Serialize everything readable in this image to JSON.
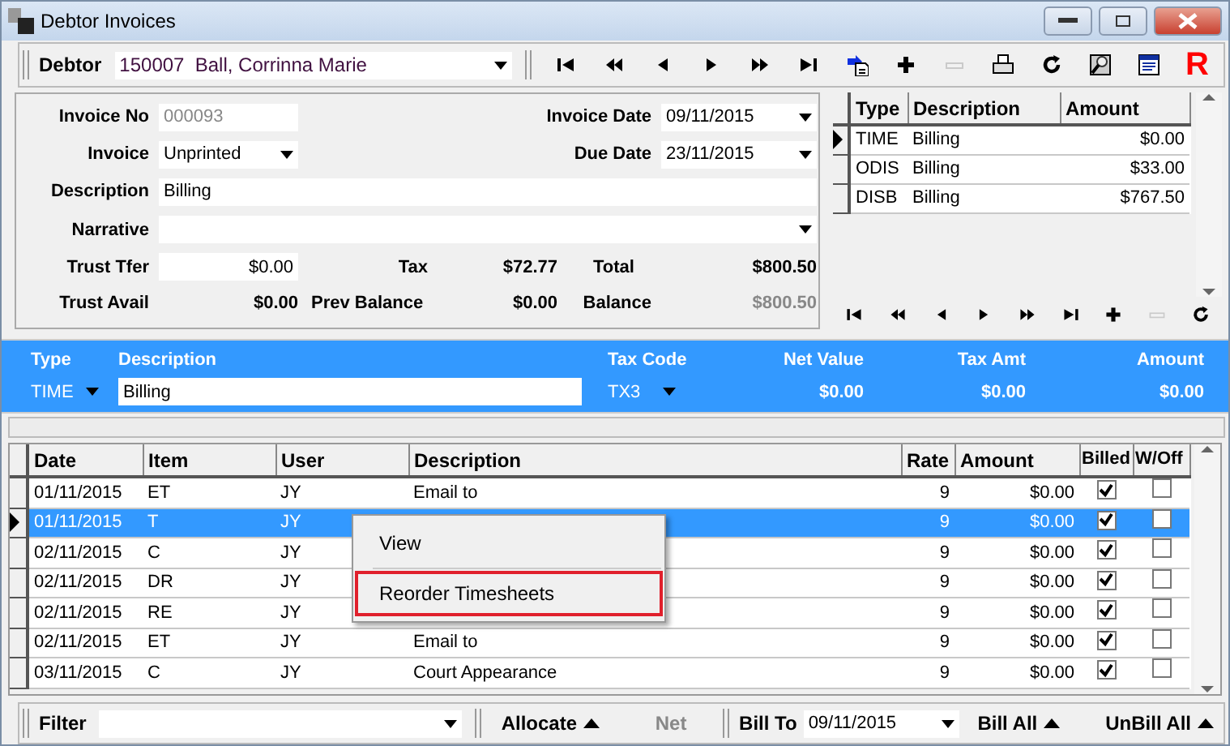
{
  "window": {
    "title": "Debtor Invoices"
  },
  "toolbar": {
    "debtor_label": "Debtor",
    "debtor_value": "150007  Ball, Corrinna Marie",
    "tools": [
      {
        "kind": "first",
        "disabled": false
      },
      {
        "kind": "prevpage",
        "disabled": false
      },
      {
        "kind": "prev",
        "disabled": false
      },
      {
        "kind": "next",
        "disabled": false
      },
      {
        "kind": "nextpage",
        "disabled": false
      },
      {
        "kind": "last",
        "disabled": false
      },
      {
        "kind": "import",
        "disabled": false
      },
      {
        "kind": "add",
        "disabled": false
      },
      {
        "kind": "remove",
        "disabled": true
      },
      {
        "kind": "print",
        "disabled": false
      },
      {
        "kind": "refresh",
        "disabled": false
      },
      {
        "kind": "find",
        "disabled": false
      },
      {
        "kind": "doc",
        "disabled": false
      },
      {
        "kind": "text",
        "label": "R",
        "disabled": false
      }
    ]
  },
  "invoice": {
    "invoice_no": {
      "label": "Invoice No",
      "value": "000093",
      "disabled": true
    },
    "invoice_date": {
      "label": "Invoice Date",
      "value": "09/11/2015"
    },
    "status": {
      "label": "Invoice",
      "value": "Unprinted"
    },
    "due_date": {
      "label": "Due Date",
      "value": "23/11/2015"
    },
    "description": {
      "label": "Description",
      "value": "Billing"
    },
    "narrative": {
      "label": "Narrative"
    },
    "trust_tfer": {
      "label": "Trust Tfer",
      "value": "$0.00"
    },
    "tax": {
      "label": "Tax",
      "value": "$72.77"
    },
    "total": {
      "label": "Total",
      "value": "$800.50"
    },
    "trust_avail": {
      "label": "Trust Avail",
      "value": "$0.00"
    },
    "prev_balance": {
      "label": "Prev Balance",
      "value": "$0.00"
    },
    "balance": {
      "label": "Balance",
      "value": "$800.50",
      "disabled": true
    }
  },
  "lines": {
    "columns": [
      "Type",
      "Description",
      "Amount"
    ],
    "rows": [
      {
        "type": "TIME",
        "description": "Billing",
        "amount": "$0.00",
        "selected": true
      },
      {
        "type": "ODIS",
        "description": "Billing",
        "amount": "$33.00",
        "selected": false
      },
      {
        "type": "DISB",
        "description": "Billing",
        "amount": "$767.50",
        "selected": false
      }
    ],
    "nav": [
      {
        "kind": "first",
        "disabled": false
      },
      {
        "kind": "prevpage",
        "disabled": false
      },
      {
        "kind": "prev",
        "disabled": false
      },
      {
        "kind": "next",
        "disabled": false
      },
      {
        "kind": "nextpage",
        "disabled": false
      },
      {
        "kind": "last",
        "disabled": false
      },
      {
        "kind": "add",
        "disabled": false
      },
      {
        "kind": "remove",
        "disabled": true
      },
      {
        "kind": "refresh",
        "disabled": false
      }
    ]
  },
  "line_editor": {
    "type_label": "Type",
    "type_value": "TIME",
    "description_label": "Description",
    "description_value": "Billing",
    "tax_code_label": "Tax Code",
    "tax_code_value": "TX3",
    "net_value_label": "Net Value",
    "net_value": "$0.00",
    "tax_amt_label": "Tax Amt",
    "tax_amt": "$0.00",
    "amount_label": "Amount",
    "amount": "$0.00"
  },
  "timesheets": {
    "columns": [
      "Date",
      "Item",
      "User",
      "Description",
      "Rate",
      "Amount",
      "Billed",
      "W/Off"
    ],
    "rows": [
      {
        "date": "01/11/2015",
        "item": "ET",
        "user": "JY",
        "description": "Email to",
        "rate": "9",
        "amount": "$0.00",
        "billed": true,
        "written_off": false,
        "selected": false
      },
      {
        "date": "01/11/2015",
        "item": "T",
        "user": "JY",
        "rate": "9",
        "amount": "$0.00",
        "billed": true,
        "written_off": false,
        "selected": true
      },
      {
        "date": "02/11/2015",
        "item": "C",
        "user": "JY",
        "rate": "9",
        "amount": "$0.00",
        "billed": true,
        "written_off": false,
        "selected": false
      },
      {
        "date": "02/11/2015",
        "item": "DR",
        "user": "JY",
        "rate": "9",
        "amount": "$0.00",
        "billed": true,
        "written_off": false,
        "selected": false
      },
      {
        "date": "02/11/2015",
        "item": "RE",
        "user": "JY",
        "rate": "9",
        "amount": "$0.00",
        "billed": true,
        "written_off": false,
        "selected": false
      },
      {
        "date": "02/11/2015",
        "item": "ET",
        "user": "JY",
        "description": "Email to",
        "rate": "9",
        "amount": "$0.00",
        "billed": true,
        "written_off": false,
        "selected": false
      },
      {
        "date": "03/11/2015",
        "item": "C",
        "user": "JY",
        "description": "Court Appearance",
        "rate": "9",
        "amount": "$0.00",
        "billed": true,
        "written_off": false,
        "selected": false
      }
    ]
  },
  "context_menu": {
    "items": [
      {
        "label": "View",
        "outlined": false
      },
      {
        "label": "Reorder Timesheets",
        "outlined": true
      }
    ]
  },
  "bottom_bar": {
    "filter_label": "Filter",
    "allocate": "Allocate",
    "net": {
      "label": "Net",
      "disabled": true
    },
    "bill_to_label": "Bill To",
    "bill_to_value": "09/11/2015",
    "bill_all": "Bill All",
    "unbill_all": "UnBill All"
  }
}
